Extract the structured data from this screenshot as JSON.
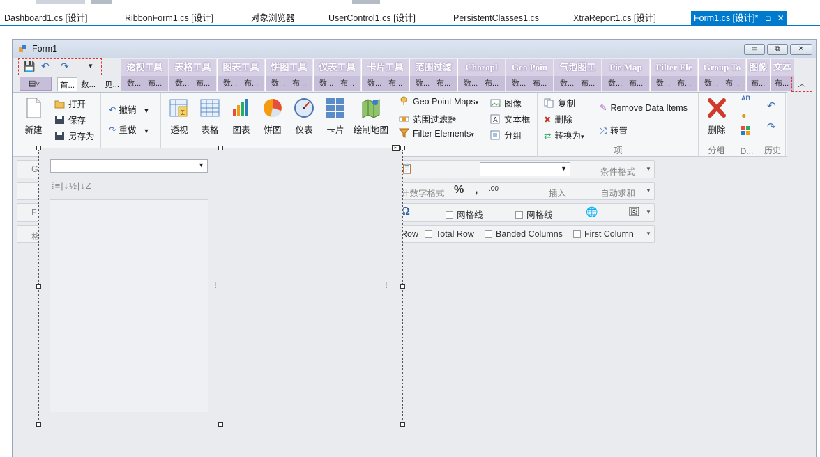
{
  "doc_tabs": [
    {
      "label": "Dashboard1.cs [设计]",
      "active": false
    },
    {
      "label": "RibbonForm1.cs [设计]",
      "active": false
    },
    {
      "label": "对象浏览器",
      "active": false
    },
    {
      "label": "UserControl1.cs [设计]",
      "active": false
    },
    {
      "label": "PersistentClasses1.cs",
      "active": false
    },
    {
      "label": "XtraReport1.cs [设计]",
      "active": false
    },
    {
      "label": "Form1.cs [设计]*",
      "active": true,
      "pin": "⊐",
      "close": "✕"
    }
  ],
  "form": {
    "title": "Form1",
    "window_buttons": {
      "minimize": "▭",
      "restore": "⧉",
      "close": "✕"
    }
  },
  "qat": {
    "save": "💾",
    "undo": "↶",
    "redo": "↷",
    "customize": "▾"
  },
  "context_tabs": [
    {
      "caption": "透视工具",
      "sub1": "数...",
      "sub2": "布..."
    },
    {
      "caption": "表格工具",
      "sub1": "数...",
      "sub2": "布..."
    },
    {
      "caption": "图表工具",
      "sub1": "数...",
      "sub2": "布..."
    },
    {
      "caption": "饼图工具",
      "sub1": "数...",
      "sub2": "布..."
    },
    {
      "caption": "仪表工具",
      "sub1": "数...",
      "sub2": "布..."
    },
    {
      "caption": "卡片工具",
      "sub1": "数...",
      "sub2": "布..."
    },
    {
      "caption": "范围过滤",
      "sub1": "数...",
      "sub2": "布..."
    },
    {
      "caption": "Choropl",
      "sub1": "数...",
      "sub2": "布..."
    },
    {
      "caption": "Geo Poin",
      "sub1": "数...",
      "sub2": "布..."
    },
    {
      "caption": "气泡图工",
      "sub1": "数...",
      "sub2": "布..."
    },
    {
      "caption": "Pie Map",
      "sub1": "数...",
      "sub2": "布..."
    },
    {
      "caption": "Filter Ele",
      "sub1": "数...",
      "sub2": "布..."
    },
    {
      "caption": "Group To",
      "sub1": "数...",
      "sub2": "布..."
    },
    {
      "caption": "图像",
      "sub1": "布...",
      "sub2": ""
    },
    {
      "caption": "文本",
      "sub1": "布...",
      "sub2": ""
    }
  ],
  "ribbon_tabs": {
    "app_menu": "▤▿",
    "home": "首...",
    "data": "数...",
    "view": "见..."
  },
  "collapse": "︿",
  "ribbon": {
    "file": {
      "new": "新建",
      "open": "打开",
      "save": "保存",
      "save_as": "另存为"
    },
    "history": {
      "undo": "撤销",
      "redo": "重做"
    },
    "insert": {
      "pivot": "透视",
      "grid": "表格",
      "chart": "图表",
      "pie": "饼图",
      "gauge": "仪表",
      "card": "卡片",
      "map": "绘制地图"
    },
    "maps": {
      "geo_point": "Geo Point Maps",
      "range_filter": "范围过滤器",
      "filter_elements": "Filter Elements"
    },
    "insert2": {
      "image": "图像",
      "textbox": "文本框",
      "group": "分组"
    },
    "item": {
      "copy": "复制",
      "delete": "删除",
      "convert": "转换为",
      "remove_data": "Remove Data Items",
      "transpose": "转置",
      "group_label": "项"
    },
    "group_grp": {
      "delete": "删除",
      "label": "分组"
    },
    "d_grp": {
      "label": "D..."
    },
    "hist_grp": {
      "label": "历史"
    }
  },
  "ghost_toolbar": {
    "row1_left": "G",
    "row1_cond": "条件格式",
    "row2_numfmt": "计数字格式",
    "row2_percent": "%",
    "row2_comma": ",",
    "row2_dec": ".00",
    "row2_insert": "插入",
    "row2_autosum": "自动求和",
    "row3_left": "F",
    "row3_omega": "Ω",
    "row3_gridlines1": "网格线",
    "row3_gridlines2": "网格线",
    "row4_left": "格",
    "row4_row": "Row",
    "row4_total": "Total Row",
    "row4_banded": "Banded Columns",
    "row4_first": "First Column"
  },
  "design": {
    "combo_value": "",
    "sort_icons": "⁞≡|↓½|↓Z"
  }
}
